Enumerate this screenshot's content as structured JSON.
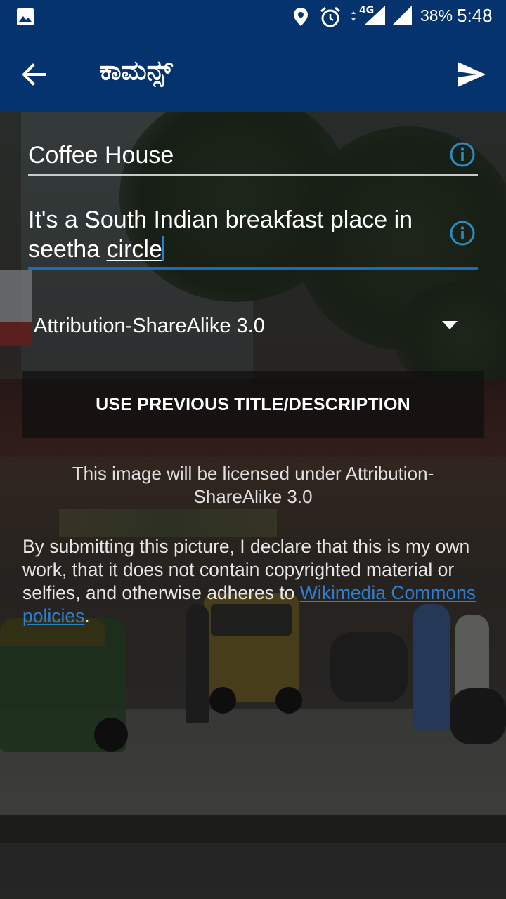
{
  "status_bar": {
    "network": "4G",
    "battery": "38%",
    "time": "5:48",
    "icons": [
      "gallery-icon",
      "location-icon",
      "alarm-icon",
      "signal-icon"
    ]
  },
  "toolbar": {
    "title": "ಕಾಮನ್ಸ್",
    "back_icon": "back-arrow-icon",
    "send_icon": "send-icon",
    "color": "#04336d"
  },
  "form": {
    "title_value": "Coffee House",
    "description_before": "It's a South Indian breakfast place in seetha ",
    "description_underlined": "circle",
    "info_icon": "info-icon",
    "license_selected": "Attribution-ShareAlike 3.0",
    "use_previous_label": "USE PREVIOUS TITLE/DESCRIPTION",
    "license_note": "This image will be licensed under Attribution-ShareAlike 3.0",
    "declaration_text": "By submitting this picture, I declare that this is my own work, that it does not contain copyrighted material or selfies, and otherwise adheres to ",
    "policy_link": "Wikimedia Commons policies",
    "declaration_end": "."
  },
  "colors": {
    "accent": "#1f6ab5",
    "link": "#2d7fd3",
    "info": "#2d8cbf"
  }
}
